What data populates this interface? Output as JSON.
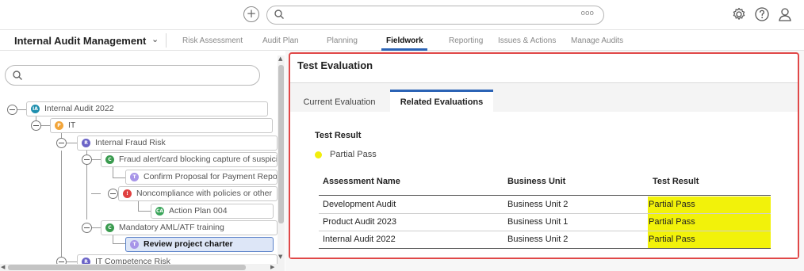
{
  "topbar": {
    "search": {
      "value": "",
      "more_label": "ooo"
    }
  },
  "nav": {
    "app_title": "Internal Audit Management",
    "items": [
      {
        "label": "Risk Assessment",
        "active": false
      },
      {
        "label": "Audit Plan",
        "active": false
      },
      {
        "label": "Planning",
        "active": false
      },
      {
        "label": "Fieldwork",
        "active": true
      },
      {
        "label": "Reporting",
        "active": false
      },
      {
        "label": "Issues & Actions",
        "active": false
      },
      {
        "label": "Manage Audits",
        "active": false
      }
    ]
  },
  "tree": {
    "search_value": "",
    "nodes": [
      {
        "label": "Internal Audit 2022",
        "badge": "IA",
        "badge_color": "#1e8fae",
        "selected": false
      },
      {
        "label": "IT",
        "badge": "P",
        "badge_color": "#f2a53a",
        "selected": false
      },
      {
        "label": "Internal Fraud Risk",
        "badge": "R",
        "badge_color": "#6a63c7",
        "selected": false
      },
      {
        "label": "Fraud alert/card blocking capture of suspiciou",
        "badge": "C",
        "badge_color": "#3a9b4f",
        "selected": false
      },
      {
        "label": "Confirm Proposal for Payment Report",
        "badge": "T",
        "badge_color": "#a795e8",
        "selected": false
      },
      {
        "label": "Noncompliance with policies or other",
        "badge": "!",
        "badge_color": "#e04040",
        "selected": false
      },
      {
        "label": "Action Plan 004",
        "badge": "CA",
        "badge_color": "#3aa55a",
        "selected": false
      },
      {
        "label": "Mandatory AML/ATF training",
        "badge": "C",
        "badge_color": "#3a9b4f",
        "selected": false
      },
      {
        "label": "Review project charter",
        "badge": "T",
        "badge_color": "#a795e8",
        "selected": true
      },
      {
        "label": "IT Competence Risk",
        "badge": "R",
        "badge_color": "#6a63c7",
        "selected": false
      }
    ]
  },
  "panel": {
    "title": "Test Evaluation",
    "tabs": [
      {
        "label": "Current Evaluation",
        "active": false
      },
      {
        "label": "Related Evaluations",
        "active": true
      }
    ],
    "test_result_label": "Test Result",
    "test_result_value": "Partial Pass",
    "status_color": "#f2ee0c",
    "table": {
      "headers": [
        "Assessment Name",
        "Business Unit",
        "Test Result"
      ],
      "rows": [
        [
          "Development Audit",
          "Business Unit 2",
          "Partial Pass"
        ],
        [
          "Product Audit 2023",
          "Business Unit 1",
          "Partial Pass"
        ],
        [
          "Internal Audit 2022",
          "Business Unit 2",
          "Partial Pass"
        ]
      ],
      "highlight_color": "#f2f20a"
    }
  }
}
